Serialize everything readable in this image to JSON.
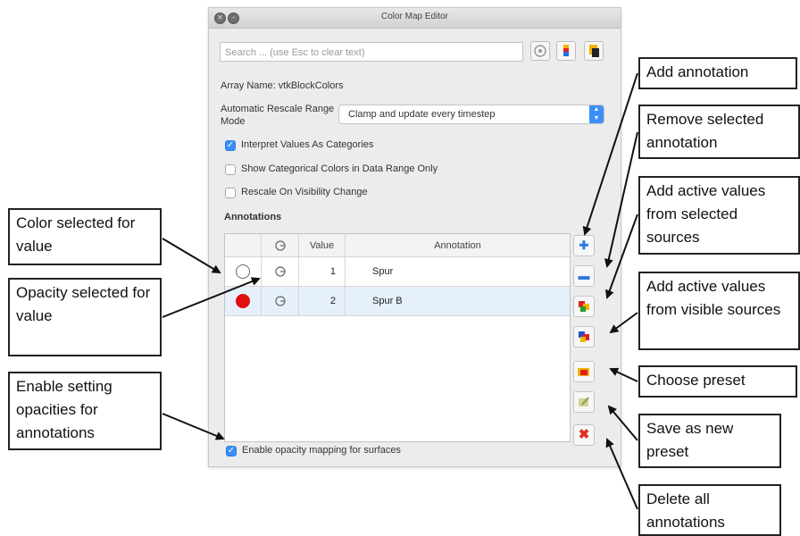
{
  "window": {
    "title": "Color Map Editor"
  },
  "search": {
    "placeholder": "Search ... (use Esc to clear text)"
  },
  "array_name": "Array Name: vtkBlockColors",
  "range_mode": {
    "label": "Automatic Rescale Range Mode",
    "value": "Clamp and update every timestep"
  },
  "checkboxes": [
    {
      "label": "Interpret Values As Categories",
      "checked": true
    },
    {
      "label": "Show Categorical Colors in Data Range Only",
      "checked": false
    },
    {
      "label": "Rescale On Visibility Change",
      "checked": false
    }
  ],
  "annotations": {
    "heading": "Annotations",
    "columns": {
      "value": "Value",
      "annotation": "Annotation"
    },
    "rows": [
      {
        "color": "#ffffff",
        "value": "1",
        "annotation": "Spur"
      },
      {
        "color": "#e01010",
        "value": "2",
        "annotation": "Spur B"
      }
    ]
  },
  "opacity_checkbox": {
    "label": "Enable opacity mapping for surfaces",
    "checked": true
  },
  "callouts": {
    "add_annotation": "Add annotation",
    "remove_selected": "Remove selected annotation",
    "add_from_selected": "Add active values from selected sources",
    "add_from_visible": "Add active values from visible sources",
    "choose_preset": "Choose preset",
    "save_preset": "Save as new preset",
    "delete_all": "Delete all annotations",
    "color_selected": "Color selected for value",
    "opacity_selected": "Opacity selected for value",
    "enable_opacities": "Enable setting opacities for annotations"
  },
  "colors": {
    "accent": "#3b8ff6",
    "selected_row": "#e6f0fb",
    "red_swatch": "#e01010"
  }
}
